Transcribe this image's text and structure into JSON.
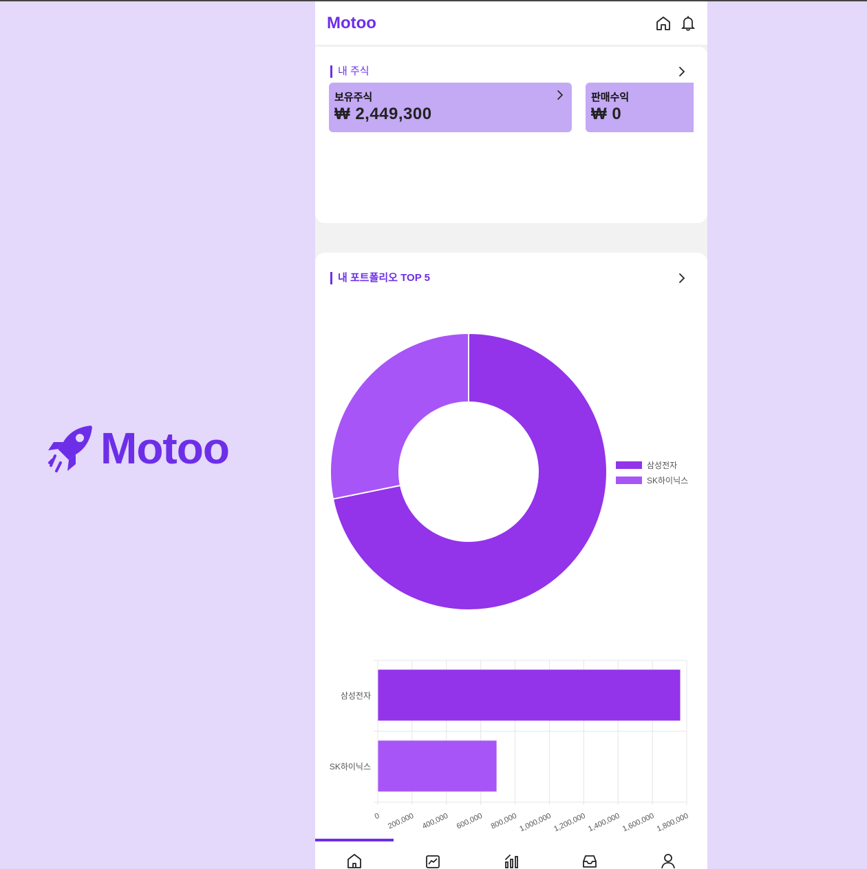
{
  "brand": {
    "name": "Motoo"
  },
  "header": {
    "title": "Motoo",
    "icons": [
      "home-icon",
      "bell-icon"
    ]
  },
  "my_stocks": {
    "title": "내 주식",
    "cards": [
      {
        "label": "보유주식",
        "value": "₩ 2,449,300"
      },
      {
        "label": "판매수익",
        "value": "₩ 0"
      }
    ]
  },
  "portfolio": {
    "title": "내 포트폴리오 TOP 5",
    "legend": [
      "삼성전자",
      "SK하이닉스"
    ]
  },
  "colors": {
    "accent": "#6d2ee8",
    "series1": "#9333ea",
    "series2": "#a855f7",
    "card": "#c4a9f4"
  },
  "chart_data": [
    {
      "type": "pie",
      "donut": true,
      "categories": [
        "삼성전자",
        "SK하이닉스"
      ],
      "values": [
        1760000,
        690000
      ],
      "legend": "right"
    },
    {
      "type": "bar",
      "orientation": "horizontal",
      "categories": [
        "삼성전자",
        "SK하이닉스"
      ],
      "values": [
        1760000,
        690000
      ],
      "xlim": [
        0,
        1800000
      ],
      "xticks": [
        "0",
        "200,000",
        "400,000",
        "600,000",
        "800,000",
        "1,000,000",
        "1,200,000",
        "1,400,000",
        "1,600,000",
        "1,800,000"
      ],
      "grid": true
    }
  ],
  "bottom_nav": {
    "items": [
      "home-icon",
      "chart-icon",
      "ranking-icon",
      "inbox-icon",
      "user-icon"
    ],
    "active": 0
  }
}
